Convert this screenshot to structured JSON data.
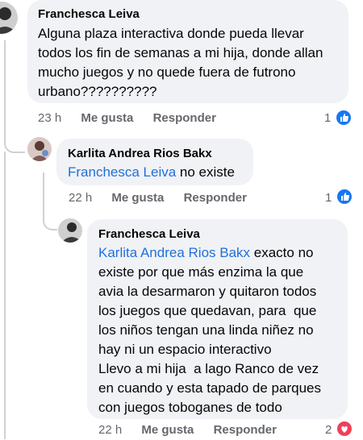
{
  "comments": [
    {
      "author": "Franchesca Leiva",
      "lines": [
        "Alguna plaza interactiva donde pueda llevar",
        "todos los fin de semanas a mi hija, donde allan",
        "mucho juegos y no quede fuera de futrono",
        "urbano??????????"
      ],
      "time": "23 h",
      "like": "Me gusta",
      "reply": "Responder",
      "reaction_count": "1",
      "reaction_icon": "like-icon",
      "reaction_color": "#1877f2"
    },
    {
      "author": "Karlita Andrea Rios Bakx",
      "mention": "Franchesca Leiva",
      "text": " no existe",
      "time": "22 h",
      "like": "Me gusta",
      "reply": "Responder",
      "reaction_count": "1",
      "reaction_icon": "like-icon",
      "reaction_color": "#1877f2"
    },
    {
      "author": "Franchesca Leiva",
      "mention": "Karlita Andrea Rios Bakx",
      "first_line_rest": " exacto no",
      "lines": [
        "existe por que más enzima la que",
        "avia la desarmaron y quitaron todos",
        "los juegos que quedavan, para  que",
        "los niños tengan una linda niñez no",
        "hay ni un espacio interactivo",
        "Llevo a mi hija  a lago Ranco de vez",
        "en cuando y esta tapado de parques",
        "con juegos toboganes de todo"
      ],
      "time": "22 h",
      "like": "Me gusta",
      "reply": "Responder",
      "reaction_count": "2",
      "reaction_icon": "love-icon",
      "reaction_color": "#f33e58"
    }
  ]
}
